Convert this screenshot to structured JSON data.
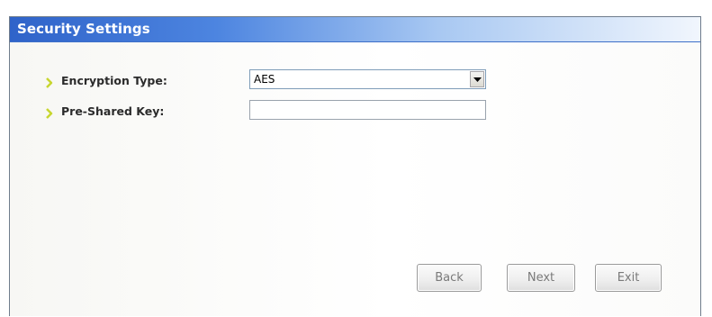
{
  "dialog": {
    "title": "Security Settings"
  },
  "fields": {
    "encryption_label": "Encryption Type:",
    "encryption_value": "AES",
    "psk_label": "Pre-Shared Key:",
    "psk_value": ""
  },
  "buttons": {
    "back": "Back",
    "next": "Next",
    "exit": "Exit"
  },
  "icons": {
    "label_marker": "arrow-bullet-icon",
    "dropdown": "chevron-down-icon"
  },
  "colors": {
    "title_bar_start": "#2f63c9",
    "title_bar_end": "#f1f6fd",
    "bullet": "#c8d630",
    "disabled_text": "#7a7a7a"
  }
}
